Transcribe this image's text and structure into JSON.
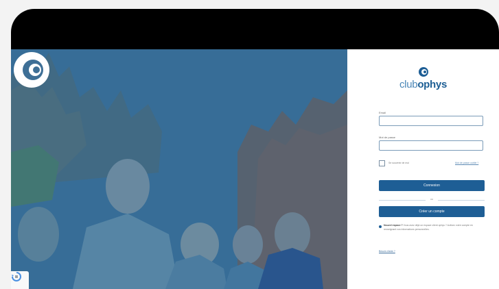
{
  "hero": {
    "logo_icon": "clubophys-c-logo-icon",
    "recaptcha_icon": "recaptcha-icon"
  },
  "brand": {
    "name_part1": "club",
    "name_part2": "ophys"
  },
  "form": {
    "email_label": "Email",
    "email_value": "",
    "password_label": "Mot de passe",
    "password_value": "",
    "remember_label": "Se souvenir de moi",
    "forgot_link": "Mot de passe oublié ?",
    "login_button": "Connexion",
    "or_text": "ou",
    "create_button": "Créer un compte"
  },
  "notice": {
    "title": "Nouvel espace ?",
    "body": "Vous avez déjà un espace client ophys ? Activez votre compte en renseignant vos informations personnelles."
  },
  "faq_link": "Besoin d'aide ?",
  "colors": {
    "brand_blue": "#1e5e95",
    "hero_overlay": "#3a6b8a"
  }
}
